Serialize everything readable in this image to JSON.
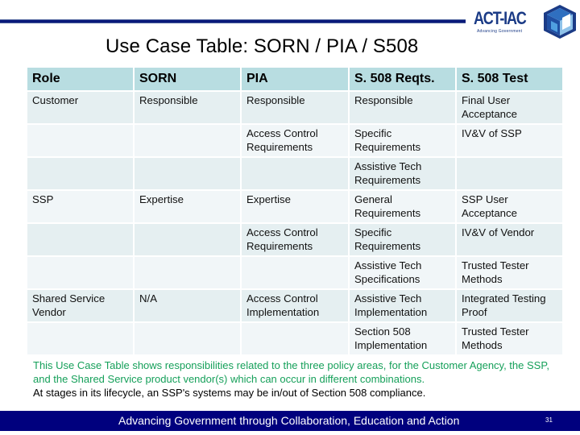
{
  "slide": {
    "title": "Use Case Table: SORN / PIA / S508",
    "logo": {
      "name": "ACT-IAC",
      "tagline": "Advancing Government",
      "icon": "act-iac-cube-logo-icon",
      "brand_color": "#1b3b86"
    },
    "top_rule_color": "#0a1a7a"
  },
  "table": {
    "headers": [
      "Role",
      "SORN",
      "PIA",
      "S. 508 Reqts.",
      "S. 508 Test"
    ],
    "header_color": "#b8dde1",
    "rows": [
      [
        "Customer",
        "Responsible",
        "Responsible",
        "Responsible",
        "Final User Acceptance"
      ],
      [
        "",
        "",
        "Access Control Requirements",
        "Specific Requirements",
        "IV&V of SSP"
      ],
      [
        "",
        "",
        "",
        "Assistive Tech Requirements",
        ""
      ],
      [
        "SSP",
        "Expertise",
        "Expertise",
        "General Requirements",
        "SSP User Acceptance"
      ],
      [
        "",
        "",
        "Access Control Requirements",
        "Specific Requirements",
        "IV&V of Vendor"
      ],
      [
        "",
        "",
        "",
        "Assistive Tech Specifications",
        "Trusted Tester Methods"
      ],
      [
        "Shared Service Vendor",
        "N/A",
        "Access Control Implementation",
        "Assistive Tech Implementation",
        "Integrated Testing Proof"
      ],
      [
        "",
        "",
        "",
        "Section 508 Implementation",
        "Trusted Tester Methods"
      ]
    ]
  },
  "note": {
    "line1": "This Use Case Table shows responsibilities related to the three policy areas, for the Customer Agency, the SSP, and the Shared Service product vendor(s) which can occur in different combinations.",
    "line2": "At stages in its lifecycle, an SSP's systems may be in/out of Section 508 compliance.",
    "line1_color": "#16a05a"
  },
  "footer": {
    "text": "Advancing Government through Collaboration, Education and Action",
    "page_number": "31",
    "background": "#00007e"
  }
}
